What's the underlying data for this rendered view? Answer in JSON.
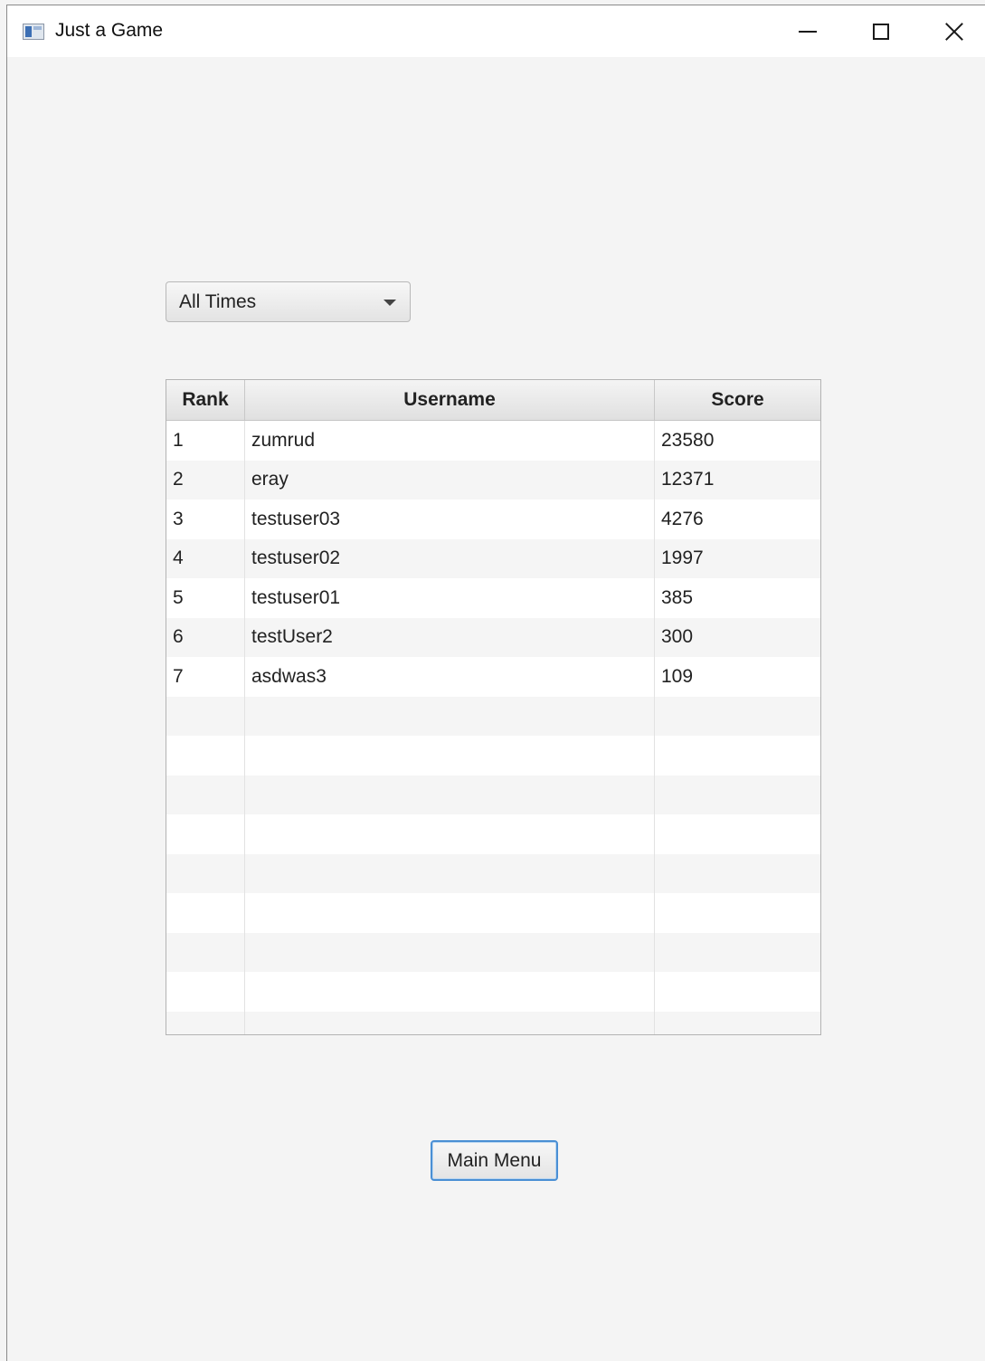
{
  "window": {
    "title": "Just a Game",
    "controls": [
      "minimize",
      "maximize",
      "close"
    ]
  },
  "filter": {
    "selected": "All Times"
  },
  "leaderboard": {
    "columns": [
      "Rank",
      "Username",
      "Score"
    ],
    "rows": [
      {
        "rank": "1",
        "username": "zumrud",
        "score": "23580"
      },
      {
        "rank": "2",
        "username": "eray",
        "score": "12371"
      },
      {
        "rank": "3",
        "username": "testuser03",
        "score": "4276"
      },
      {
        "rank": "4",
        "username": "testuser02",
        "score": "1997"
      },
      {
        "rank": "5",
        "username": "testuser01",
        "score": "385"
      },
      {
        "rank": "6",
        "username": "testUser2",
        "score": "300"
      },
      {
        "rank": "7",
        "username": "asdwas3",
        "score": "109"
      }
    ]
  },
  "actions": {
    "main_menu_label": "Main Menu"
  }
}
